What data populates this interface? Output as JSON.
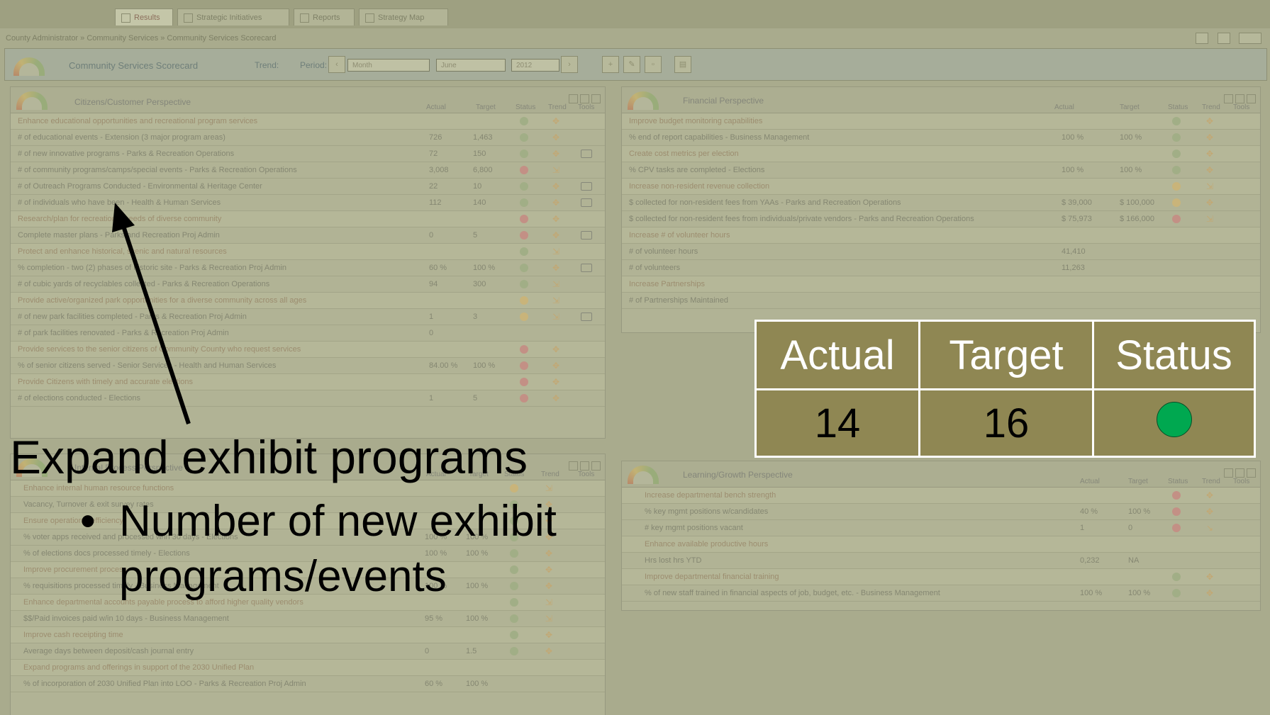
{
  "tabs": [
    {
      "label": "Results",
      "active": true
    },
    {
      "label": "Strategic Initiatives",
      "active": false
    },
    {
      "label": "Reports",
      "active": false
    },
    {
      "label": "Strategy Map",
      "active": false
    }
  ],
  "breadcrumb": "County Administrator » Community Services » Community Services Scorecard",
  "toolbar": {
    "title": "Community Services Scorecard",
    "trend_label": "Trend:",
    "period_label": "Period:",
    "period_type": "Month",
    "period_month": "June",
    "period_year": "2012"
  },
  "left_panel": {
    "title": "Citizens/Customer Perspective",
    "columns": [
      "Actual",
      "Target",
      "Status",
      "Trend",
      "Tools"
    ],
    "rows": [
      {
        "name": "Enhance educational opportunities and recreational program services",
        "actual": "",
        "target": "",
        "status": "green",
        "trend": "up",
        "tool": false,
        "obj": true
      },
      {
        "name": "# of educational events - Extension (3 major program areas)",
        "actual": "726",
        "target": "1,463",
        "status": "green",
        "trend": "up",
        "tool": false,
        "obj": false
      },
      {
        "name": "# of new innovative programs - Parks & Recreation Operations",
        "actual": "72",
        "target": "150",
        "status": "green",
        "trend": "up",
        "tool": true,
        "obj": false
      },
      {
        "name": "# of community programs/camps/special events - Parks & Recreation Operations",
        "actual": "3,008",
        "target": "6,800",
        "status": "red",
        "trend": "flat",
        "tool": false,
        "obj": false
      },
      {
        "name": "# of Outreach Programs Conducted - Environmental & Heritage Center",
        "actual": "22",
        "target": "10",
        "status": "green",
        "trend": "up",
        "tool": true,
        "obj": false
      },
      {
        "name": "# of individuals who have been - Health & Human Services",
        "actual": "112",
        "target": "140",
        "status": "green",
        "trend": "up",
        "tool": true,
        "obj": false
      },
      {
        "name": "Research/plan for recreational needs of diverse community",
        "actual": "",
        "target": "",
        "status": "red",
        "trend": "up",
        "tool": false,
        "obj": true
      },
      {
        "name": "Complete master plans - Parks and Recreation Proj Admin",
        "actual": "0",
        "target": "5",
        "status": "red",
        "trend": "up",
        "tool": true,
        "obj": false
      },
      {
        "name": "Protect and enhance historical, scenic and natural resources",
        "actual": "",
        "target": "",
        "status": "green",
        "trend": "flat",
        "tool": false,
        "obj": true
      },
      {
        "name": "% completion - two (2) phases of historic site - Parks & Recreation Proj Admin",
        "actual": "60 %",
        "target": "100 %",
        "status": "green",
        "trend": "up",
        "tool": true,
        "obj": false
      },
      {
        "name": "# of cubic yards of recyclables collected - Parks & Recreation Operations",
        "actual": "94",
        "target": "300",
        "status": "green",
        "trend": "flat",
        "tool": false,
        "obj": false
      },
      {
        "name": "Provide active/organized park opportunities for a diverse community across all ages",
        "actual": "",
        "target": "",
        "status": "yellow",
        "trend": "flat",
        "tool": false,
        "obj": true
      },
      {
        "name": "# of new park facilities completed - Parks & Recreation Proj Admin",
        "actual": "1",
        "target": "3",
        "status": "yellow",
        "trend": "flat",
        "tool": true,
        "obj": false
      },
      {
        "name": "# of park facilities renovated - Parks & Recreation Proj Admin",
        "actual": "0",
        "target": "",
        "status": "",
        "trend": "",
        "tool": false,
        "obj": false
      },
      {
        "name": "Provide services to the senior citizens of Community County who request services",
        "actual": "",
        "target": "",
        "status": "red",
        "trend": "up",
        "tool": false,
        "obj": true
      },
      {
        "name": "% of senior citizens served - Senior Services - Health and Human Services",
        "actual": "84.00 %",
        "target": "100 %",
        "status": "red",
        "trend": "up",
        "tool": false,
        "obj": false
      },
      {
        "name": "Provide Citizens with timely and accurate elections",
        "actual": "",
        "target": "",
        "status": "red",
        "trend": "up",
        "tool": false,
        "obj": true
      },
      {
        "name": "# of elections conducted - Elections",
        "actual": "1",
        "target": "5",
        "status": "red",
        "trend": "up",
        "tool": false,
        "obj": false
      }
    ]
  },
  "left_panel2": {
    "title": "Internal Process Perspective",
    "columns": [
      "Actual",
      "Target",
      "Status",
      "Trend",
      "Tools"
    ],
    "rows": [
      {
        "name": "Enhance internal human resource functions",
        "actual": "",
        "target": "",
        "status": "yellow",
        "trend": "flat",
        "obj": true
      },
      {
        "name": "Vacancy, Turnover & exit survey rates",
        "actual": "",
        "target": "",
        "status": "green",
        "trend": "up",
        "obj": false
      },
      {
        "name": "Ensure operational efficiency",
        "actual": "",
        "target": "",
        "status": "green",
        "trend": "up",
        "obj": true
      },
      {
        "name": "% voter apps received and processed w/in 30 days - Elections",
        "actual": "100 %",
        "target": "100 %",
        "status": "green",
        "trend": "up",
        "obj": false
      },
      {
        "name": "% of elections docs processed timely - Elections",
        "actual": "100 %",
        "target": "100 %",
        "status": "green",
        "trend": "up",
        "obj": false
      },
      {
        "name": "Improve procurement process",
        "actual": "",
        "target": "",
        "status": "green",
        "trend": "up",
        "obj": true
      },
      {
        "name": "% requisitions processed timely - Business Management",
        "actual": "100 %",
        "target": "100 %",
        "status": "green",
        "trend": "up",
        "obj": false
      },
      {
        "name": "Enhance departmental accounts payable process to afford higher quality vendors",
        "actual": "",
        "target": "",
        "status": "green",
        "trend": "flat",
        "obj": true
      },
      {
        "name": "$$/Paid invoices paid w/in 10 days - Business Management",
        "actual": "95 %",
        "target": "100 %",
        "status": "green",
        "trend": "flat",
        "obj": false
      },
      {
        "name": "Improve cash receipting time",
        "actual": "",
        "target": "",
        "status": "green",
        "trend": "up",
        "obj": true
      },
      {
        "name": "Average days between deposit/cash journal entry",
        "actual": "0",
        "target": "1.5",
        "status": "green",
        "trend": "up",
        "obj": false
      },
      {
        "name": "Expand programs and offerings in support of the 2030 Unified Plan",
        "actual": "",
        "target": "",
        "status": "",
        "trend": "",
        "obj": true
      },
      {
        "name": "% of incorporation of 2030 Unified Plan into LOO - Parks & Recreation Proj Admin",
        "actual": "60 %",
        "target": "100 %",
        "status": "",
        "trend": "",
        "obj": false
      }
    ]
  },
  "right_panel": {
    "title": "Financial Perspective",
    "columns": [
      "Actual",
      "Target",
      "Status",
      "Trend",
      "Tools"
    ],
    "rows": [
      {
        "name": "Improve budget monitoring capabilities",
        "actual": "",
        "target": "",
        "status": "green",
        "trend": "up",
        "obj": true
      },
      {
        "name": "% end of report capabilities - Business Management",
        "actual": "100 %",
        "target": "100 %",
        "status": "green",
        "trend": "up",
        "obj": false
      },
      {
        "name": "Create cost metrics per election",
        "actual": "",
        "target": "",
        "status": "green",
        "trend": "up",
        "obj": true
      },
      {
        "name": "% CPV tasks are completed - Elections",
        "actual": "100 %",
        "target": "100 %",
        "status": "green",
        "trend": "up",
        "obj": false
      },
      {
        "name": "Increase non-resident revenue collection",
        "actual": "",
        "target": "",
        "status": "yellow",
        "trend": "flat",
        "obj": true
      },
      {
        "name": "$ collected for non-resident fees from YAAs - Parks and Recreation Operations",
        "actual": "$ 39,000",
        "target": "$ 100,000",
        "status": "yellow",
        "trend": "up",
        "obj": false
      },
      {
        "name": "$ collected for non-resident fees from individuals/private vendors - Parks and Recreation Operations",
        "actual": "$ 75,973",
        "target": "$ 166,000",
        "status": "red",
        "trend": "flat",
        "obj": false
      },
      {
        "name": "Increase # of volunteer hours",
        "actual": "",
        "target": "",
        "status": "",
        "trend": "",
        "obj": true
      },
      {
        "name": "# of volunteer hours",
        "actual": "41,410",
        "target": "",
        "status": "",
        "trend": "",
        "obj": false
      },
      {
        "name": "# of volunteers",
        "actual": "11,263",
        "target": "",
        "status": "",
        "trend": "",
        "obj": false
      },
      {
        "name": "Increase Partnerships",
        "actual": "",
        "target": "",
        "status": "",
        "trend": "",
        "obj": true
      },
      {
        "name": "# of Partnerships Maintained",
        "actual": "",
        "target": "",
        "status": "",
        "trend": "",
        "obj": false
      }
    ]
  },
  "right_panel2": {
    "title": "Learning/Growth Perspective",
    "columns": [
      "Actual",
      "Target",
      "Status",
      "Trend",
      "Tools"
    ],
    "rows": [
      {
        "name": "Increase departmental bench strength",
        "actual": "",
        "target": "",
        "status": "red",
        "trend": "up",
        "obj": true
      },
      {
        "name": "% key mgmt positions w/candidates",
        "actual": "40 %",
        "target": "100 %",
        "status": "red",
        "trend": "up",
        "obj": false
      },
      {
        "name": "# key mgmt positions vacant",
        "actual": "1",
        "target": "0",
        "status": "red",
        "trend": "down",
        "obj": false
      },
      {
        "name": "Enhance available productive hours",
        "actual": "",
        "target": "",
        "status": "",
        "trend": "",
        "obj": true
      },
      {
        "name": "Hrs lost hrs YTD",
        "actual": "0,232",
        "target": "NA",
        "status": "",
        "trend": "",
        "obj": false
      },
      {
        "name": "Improve departmental financial training",
        "actual": "",
        "target": "",
        "status": "green",
        "trend": "up",
        "obj": true
      },
      {
        "name": "% of new staff trained in financial aspects of job, budget, etc. - Business Management",
        "actual": "100 %",
        "target": "100 %",
        "status": "green",
        "trend": "up",
        "obj": false
      }
    ]
  },
  "callout": {
    "headers": [
      "Actual",
      "Target",
      "Status"
    ],
    "values": [
      "14",
      "16",
      ""
    ],
    "status_color": "#00a850"
  },
  "annotation": {
    "title": "Expand exhibit programs",
    "bullet_char": "•",
    "bullet_line1": "Number of new exhibit",
    "bullet_line2": "programs/events"
  },
  "colors": {
    "overlay": "#a9ab8d",
    "callout_bg": "#8f8753",
    "status_green": "#00a850"
  }
}
